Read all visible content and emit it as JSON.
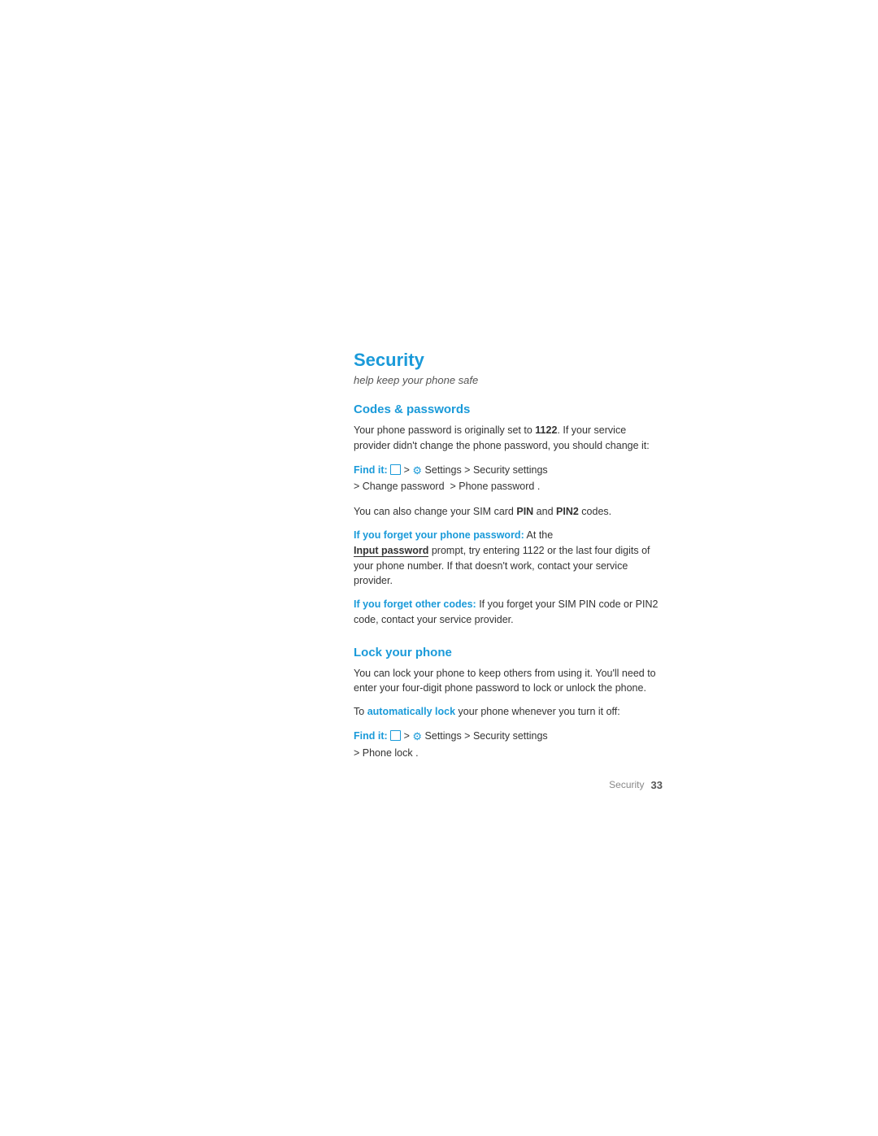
{
  "page": {
    "title": "Security",
    "subtitle": "help keep your phone safe",
    "sections": [
      {
        "id": "codes-passwords",
        "title": "Codes & passwords",
        "intro": "Your phone password is originally set to 1122. If your service provider didn't change the phone password, you should change it:",
        "intro_bold": "1122",
        "find_it_1": {
          "label": "Find it:",
          "path": "Settings > Security settings > Change password > Phone password"
        },
        "sim_text": "You can also change your SIM card ",
        "sim_bold1": "PIN",
        "sim_text2": " and ",
        "sim_bold2": "PIN2",
        "sim_text3": " codes.",
        "forget_password_label": "If you forget your phone password:",
        "forget_password_text": " At the ",
        "input_password_label": "Input password",
        "forget_password_text2": "   prompt, try entering 1122 or the last four digits of your phone number. If that doesn't work, contact your service provider.",
        "forget_codes_label": "If you forget other codes:",
        "forget_codes_text": " If you forget your SIM PIN code or PIN2 code, contact your service provider."
      },
      {
        "id": "lock-phone",
        "title": "Lock your phone",
        "intro": "You can lock your phone to keep others from using it. You'll need to enter your four-digit phone password to lock or unlock the phone.",
        "auto_lock_text1": "To ",
        "auto_lock_label": "automatically lock",
        "auto_lock_text2": " your phone whenever you turn it off:",
        "find_it_2": {
          "label": "Find it:",
          "path": "Settings > Security settings > Phone lock"
        }
      }
    ],
    "footer": {
      "section_label": "Security",
      "page_number": "33"
    }
  }
}
